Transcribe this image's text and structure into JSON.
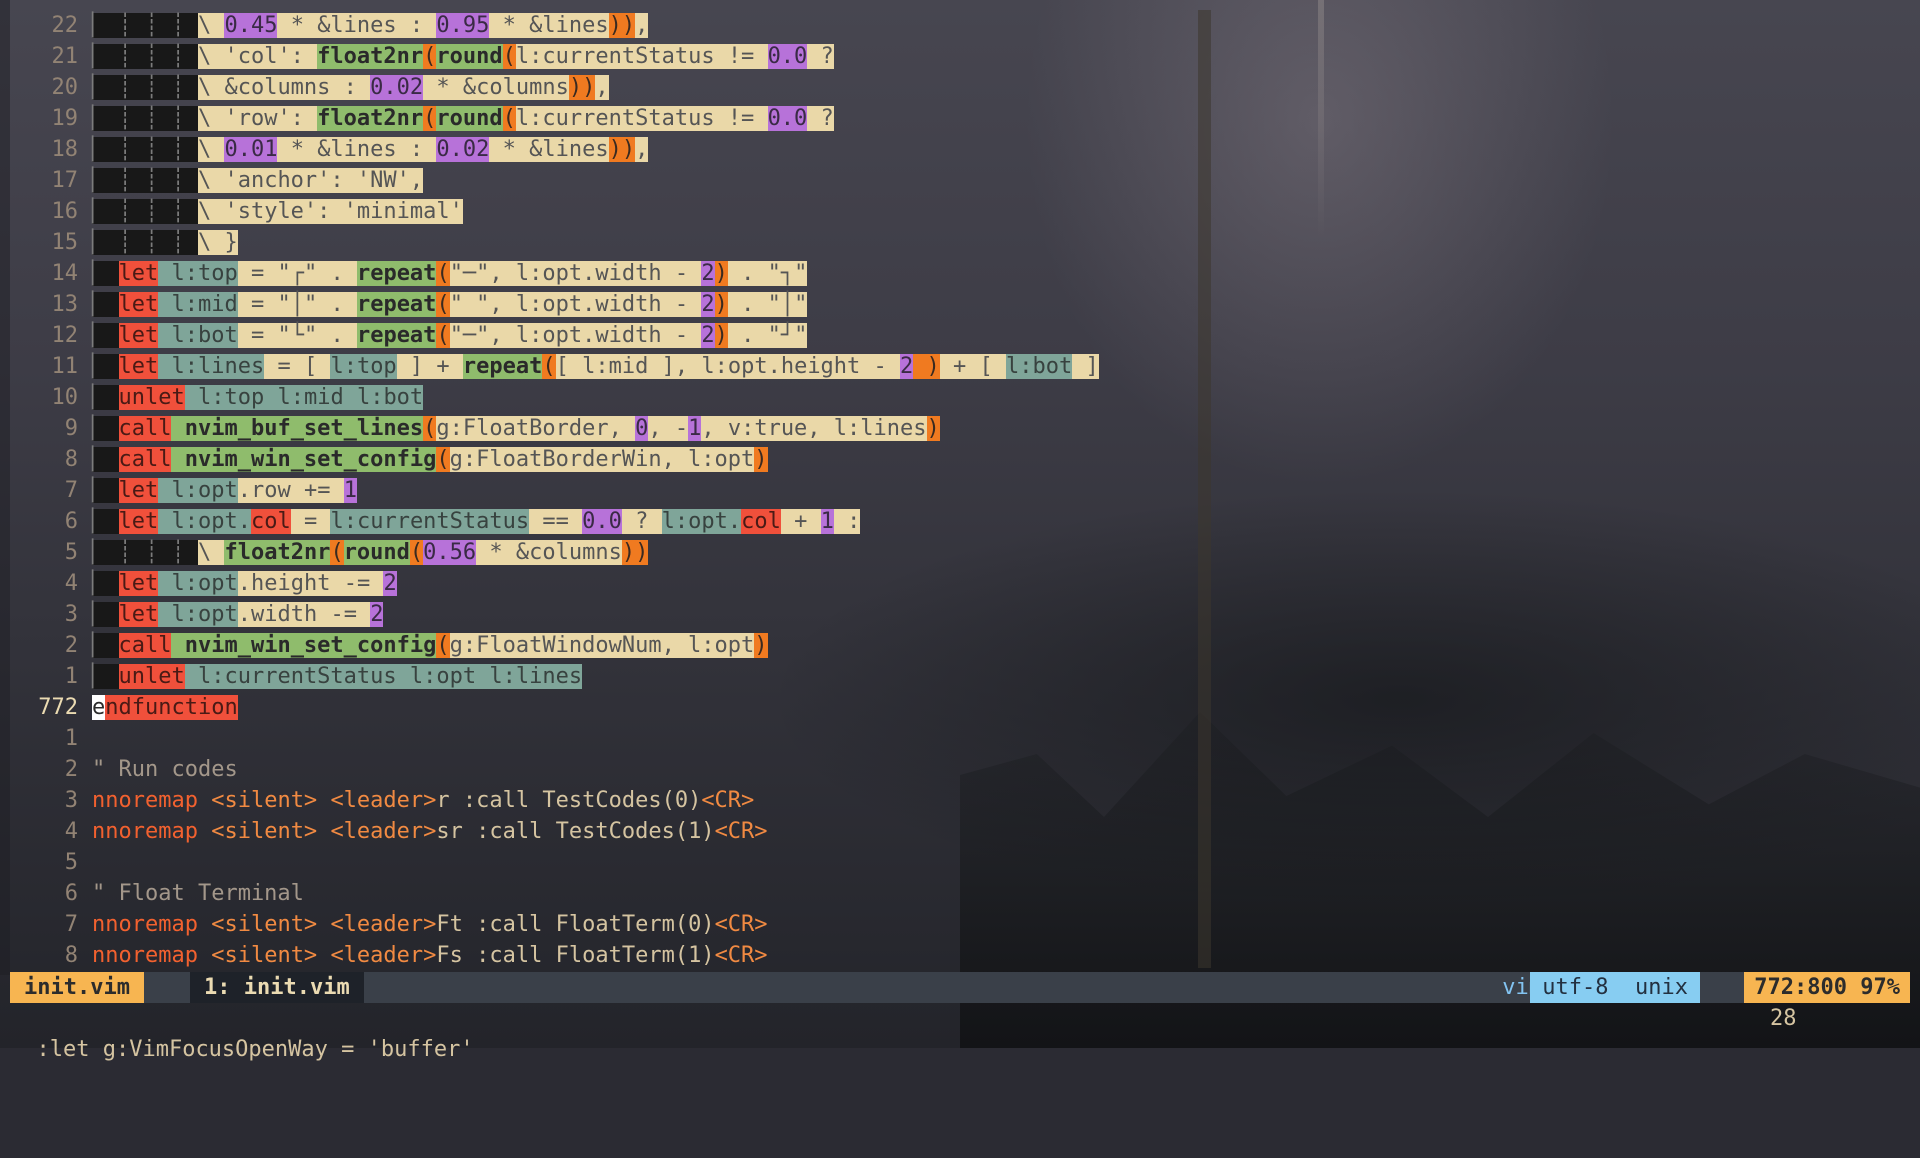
{
  "colors": {
    "keyword": "#f2612f",
    "string_tag": "#f18a42",
    "number_bg": "#b772d9",
    "function_bg": "#8fbc6c",
    "paren_bg": "#f07a20",
    "let_bg": "#f0503b",
    "var_bg": "#7fa599",
    "line_bg": "#ead8a8",
    "status_accent": "#f7b551",
    "status_info": "#87cdf2"
  },
  "lines": [
    {
      "num": "22",
      "segs": [
        [
          "",
          "guide",
          "▏ ┊ ┊ ┊ "
        ],
        [
          "",
          "g",
          "\\ "
        ],
        [
          "",
          "n",
          "0.45"
        ],
        [
          "",
          "g",
          " * &lines : "
        ],
        [
          "",
          "n",
          "0.95"
        ],
        [
          "",
          "g",
          " * &lines"
        ],
        [
          "",
          "o",
          "))"
        ],
        [
          "",
          "g",
          ","
        ]
      ]
    },
    {
      "num": "21",
      "segs": [
        [
          "",
          "guide",
          "▏ ┊ ┊ ┊ "
        ],
        [
          "",
          "g",
          "\\ 'col': "
        ],
        [
          "",
          "f",
          "float2nr"
        ],
        [
          "",
          "o",
          "("
        ],
        [
          "",
          "f",
          "round"
        ],
        [
          "",
          "o",
          "("
        ],
        [
          "",
          "g",
          "l:currentStatus != "
        ],
        [
          "",
          "n",
          "0.0"
        ],
        [
          "",
          "g",
          " ?"
        ]
      ]
    },
    {
      "num": "20",
      "segs": [
        [
          "",
          "guide",
          "▏ ┊ ┊ ┊ "
        ],
        [
          "",
          "g",
          "\\ &columns : "
        ],
        [
          "",
          "n",
          "0.02"
        ],
        [
          "",
          "g",
          " * &columns"
        ],
        [
          "",
          "o",
          "))"
        ],
        [
          "",
          "g",
          ","
        ]
      ]
    },
    {
      "num": "19",
      "segs": [
        [
          "",
          "guide",
          "▏ ┊ ┊ ┊ "
        ],
        [
          "",
          "g",
          "\\ 'row': "
        ],
        [
          "",
          "f",
          "float2nr"
        ],
        [
          "",
          "o",
          "("
        ],
        [
          "",
          "f",
          "round"
        ],
        [
          "",
          "o",
          "("
        ],
        [
          "",
          "g",
          "l:currentStatus != "
        ],
        [
          "",
          "n",
          "0.0"
        ],
        [
          "",
          "g",
          " ?"
        ]
      ]
    },
    {
      "num": "18",
      "segs": [
        [
          "",
          "guide",
          "▏ ┊ ┊ ┊ "
        ],
        [
          "",
          "g",
          "\\ "
        ],
        [
          "",
          "n",
          "0.01"
        ],
        [
          "",
          "g",
          " * &lines : "
        ],
        [
          "",
          "n",
          "0.02"
        ],
        [
          "",
          "g",
          " * &lines"
        ],
        [
          "",
          "o",
          "))"
        ],
        [
          "",
          "g",
          ","
        ]
      ]
    },
    {
      "num": "17",
      "segs": [
        [
          "",
          "guide",
          "▏ ┊ ┊ ┊ "
        ],
        [
          "",
          "g",
          "\\ 'anchor': 'NW',"
        ]
      ]
    },
    {
      "num": "16",
      "segs": [
        [
          "",
          "guide",
          "▏ ┊ ┊ ┊ "
        ],
        [
          "",
          "g",
          "\\ 'style': 'minimal'"
        ]
      ]
    },
    {
      "num": "15",
      "segs": [
        [
          "",
          "guide",
          "▏ ┊ ┊ ┊ "
        ],
        [
          "",
          "g",
          "\\ }"
        ]
      ]
    },
    {
      "num": "14",
      "segs": [
        [
          "",
          "guide",
          "▏ "
        ],
        [
          "",
          "r",
          "let"
        ],
        [
          "",
          "t",
          " l:top"
        ],
        [
          "",
          "g",
          " = \"┌\" . "
        ],
        [
          "",
          "f",
          "repeat"
        ],
        [
          "",
          "o",
          "("
        ],
        [
          "",
          "g",
          "\"─\", l:opt.width - "
        ],
        [
          "",
          "n",
          "2"
        ],
        [
          "",
          "o",
          ")"
        ],
        [
          "",
          "g",
          " . \"┐\""
        ]
      ]
    },
    {
      "num": "13",
      "segs": [
        [
          "",
          "guide",
          "▏ "
        ],
        [
          "",
          "r",
          "let"
        ],
        [
          "",
          "t",
          " l:mid"
        ],
        [
          "",
          "g",
          " = \"│\" . "
        ],
        [
          "",
          "f",
          "repeat"
        ],
        [
          "",
          "o",
          "("
        ],
        [
          "",
          "g",
          "\" \", l:opt.width - "
        ],
        [
          "",
          "n",
          "2"
        ],
        [
          "",
          "o",
          ")"
        ],
        [
          "",
          "g",
          " . \"│\""
        ]
      ]
    },
    {
      "num": "12",
      "segs": [
        [
          "",
          "guide",
          "▏ "
        ],
        [
          "",
          "r",
          "let"
        ],
        [
          "",
          "t",
          " l:bot"
        ],
        [
          "",
          "g",
          " = \"└\" . "
        ],
        [
          "",
          "f",
          "repeat"
        ],
        [
          "",
          "o",
          "("
        ],
        [
          "",
          "g",
          "\"─\", l:opt.width - "
        ],
        [
          "",
          "n",
          "2"
        ],
        [
          "",
          "o",
          ")"
        ],
        [
          "",
          "g",
          " . \"┘\""
        ]
      ]
    },
    {
      "num": "11",
      "segs": [
        [
          "",
          "guide",
          "▏ "
        ],
        [
          "",
          "r",
          "let"
        ],
        [
          "",
          "t",
          " l:lines"
        ],
        [
          "",
          "g",
          " = [ "
        ],
        [
          "",
          "t",
          "l:top"
        ],
        [
          "",
          "g",
          " ] + "
        ],
        [
          "",
          "f",
          "repeat"
        ],
        [
          "",
          "o",
          "("
        ],
        [
          "",
          "g",
          "[ l:mid ], l:opt.height - "
        ],
        [
          "",
          "n",
          "2"
        ],
        [
          "",
          "o",
          " )"
        ],
        [
          "",
          "g",
          " + [ "
        ],
        [
          "",
          "t",
          "l:bot"
        ],
        [
          "",
          "g",
          " ]"
        ]
      ]
    },
    {
      "num": "10",
      "segs": [
        [
          "",
          "guide",
          "▏ "
        ],
        [
          "",
          "r",
          "unlet"
        ],
        [
          "",
          "t",
          " l:top"
        ],
        [
          "",
          "t",
          " l:mid"
        ],
        [
          "",
          "t",
          " l:bot"
        ]
      ]
    },
    {
      "num": "9",
      "segs": [
        [
          "",
          "guide",
          "▏ "
        ],
        [
          "",
          "r",
          "call"
        ],
        [
          "",
          "f",
          " nvim_buf_set_lines"
        ],
        [
          "",
          "o",
          "("
        ],
        [
          "",
          "g",
          "g:FloatBorder, "
        ],
        [
          "",
          "n",
          "0"
        ],
        [
          "",
          "g",
          ", -"
        ],
        [
          "",
          "n",
          "1"
        ],
        [
          "",
          "g",
          ", v:true, l:lines"
        ],
        [
          "",
          "o",
          ")"
        ]
      ]
    },
    {
      "num": "8",
      "segs": [
        [
          "",
          "guide",
          "▏ "
        ],
        [
          "",
          "r",
          "call"
        ],
        [
          "",
          "f",
          " nvim_win_set_config"
        ],
        [
          "",
          "o",
          "("
        ],
        [
          "",
          "g",
          "g:FloatBorderWin, l:opt"
        ],
        [
          "",
          "o",
          ")"
        ]
      ]
    },
    {
      "num": "7",
      "segs": [
        [
          "",
          "guide",
          "▏ "
        ],
        [
          "",
          "r",
          "let"
        ],
        [
          "",
          "t",
          " l:opt"
        ],
        [
          "",
          "g",
          ".row += "
        ],
        [
          "",
          "n",
          "1"
        ]
      ]
    },
    {
      "num": "6",
      "segs": [
        [
          "",
          "guide",
          "▏ "
        ],
        [
          "",
          "r",
          "let"
        ],
        [
          "",
          "t",
          " l:opt."
        ],
        [
          "",
          "r",
          "col"
        ],
        [
          "",
          "g",
          " = "
        ],
        [
          "",
          "t",
          "l:currentStatus"
        ],
        [
          "",
          "g",
          " == "
        ],
        [
          "",
          "n",
          "0.0"
        ],
        [
          "",
          "g",
          " ? "
        ],
        [
          "",
          "t",
          "l:opt."
        ],
        [
          "",
          "r",
          "col"
        ],
        [
          "",
          "g",
          " + "
        ],
        [
          "",
          "n",
          "1"
        ],
        [
          "",
          "g",
          " :"
        ]
      ]
    },
    {
      "num": "5",
      "segs": [
        [
          "",
          "guide",
          "▏ ┊ ┊ ┊ "
        ],
        [
          "",
          "g",
          "\\ "
        ],
        [
          "",
          "f",
          "float2nr"
        ],
        [
          "",
          "o",
          "("
        ],
        [
          "",
          "f",
          "round"
        ],
        [
          "",
          "o",
          "("
        ],
        [
          "",
          "n",
          "0.56"
        ],
        [
          "",
          "g",
          " * &columns"
        ],
        [
          "",
          "o",
          "))"
        ]
      ]
    },
    {
      "num": "4",
      "segs": [
        [
          "",
          "guide",
          "▏ "
        ],
        [
          "",
          "r",
          "let"
        ],
        [
          "",
          "t",
          " l:opt"
        ],
        [
          "",
          "g",
          ".height -= "
        ],
        [
          "",
          "n",
          "2"
        ]
      ]
    },
    {
      "num": "3",
      "segs": [
        [
          "",
          "guide",
          "▏ "
        ],
        [
          "",
          "r",
          "let"
        ],
        [
          "",
          "t",
          " l:opt"
        ],
        [
          "",
          "g",
          ".width -= "
        ],
        [
          "",
          "n",
          "2"
        ]
      ]
    },
    {
      "num": "2",
      "segs": [
        [
          "",
          "guide",
          "▏ "
        ],
        [
          "",
          "r",
          "call"
        ],
        [
          "",
          "f",
          " nvim_win_set_config"
        ],
        [
          "",
          "o",
          "("
        ],
        [
          "",
          "g",
          "g:FloatWindowNum, l:opt"
        ],
        [
          "",
          "o",
          ")"
        ]
      ]
    },
    {
      "num": "1",
      "segs": [
        [
          "",
          "guide",
          "▏ "
        ],
        [
          "",
          "r",
          "unlet"
        ],
        [
          "",
          "t",
          " l:currentStatus"
        ],
        [
          "",
          "t",
          " l:opt"
        ],
        [
          "",
          "t",
          " l:lines"
        ]
      ]
    },
    {
      "num": "772",
      "cur": true,
      "segs": [
        [
          "",
          "cursor",
          "e"
        ],
        [
          "",
          "r",
          "ndfunction"
        ]
      ]
    },
    {
      "num": "1",
      "segs": []
    },
    {
      "num": "2",
      "segs": [
        [
          "",
          "c",
          "\" Run codes"
        ]
      ]
    },
    {
      "num": "3",
      "segs": [
        [
          "",
          "k",
          "nnoremap"
        ],
        [
          "",
          "w",
          " "
        ],
        [
          "",
          "s",
          "<silent>"
        ],
        [
          "",
          "w",
          " "
        ],
        [
          "",
          "s",
          "<leader>"
        ],
        [
          "",
          "w",
          "r :call TestCodes(0)"
        ],
        [
          "",
          "s",
          "<CR>"
        ]
      ]
    },
    {
      "num": "4",
      "segs": [
        [
          "",
          "k",
          "nnoremap"
        ],
        [
          "",
          "w",
          " "
        ],
        [
          "",
          "s",
          "<silent>"
        ],
        [
          "",
          "w",
          " "
        ],
        [
          "",
          "s",
          "<leader>"
        ],
        [
          "",
          "w",
          "sr :call TestCodes(1)"
        ],
        [
          "",
          "s",
          "<CR>"
        ]
      ]
    },
    {
      "num": "5",
      "segs": []
    },
    {
      "num": "6",
      "segs": [
        [
          "",
          "c",
          "\" Float Terminal"
        ]
      ]
    },
    {
      "num": "7",
      "segs": [
        [
          "",
          "k",
          "nnoremap"
        ],
        [
          "",
          "w",
          " "
        ],
        [
          "",
          "s",
          "<silent>"
        ],
        [
          "",
          "w",
          " "
        ],
        [
          "",
          "s",
          "<leader>"
        ],
        [
          "",
          "w",
          "Ft :call FloatTerm(0)"
        ],
        [
          "",
          "s",
          "<CR>"
        ]
      ]
    },
    {
      "num": "8",
      "segs": [
        [
          "",
          "k",
          "nnoremap"
        ],
        [
          "",
          "w",
          " "
        ],
        [
          "",
          "s",
          "<silent>"
        ],
        [
          "",
          "w",
          " "
        ],
        [
          "",
          "s",
          "<leader>"
        ],
        [
          "",
          "w",
          "Fs :call FloatTerm(1)"
        ],
        [
          "",
          "s",
          "<CR>"
        ]
      ]
    }
  ],
  "statusline": {
    "mode_file": "init.vim",
    "tab": "1: init.vim",
    "filetype": "vim",
    "encoding": "utf-8  unix",
    "position": "772:800 97%"
  },
  "cmdline": {
    "text": ":let g:VimFocusOpenWay = 'buffer'",
    "right": "28"
  }
}
